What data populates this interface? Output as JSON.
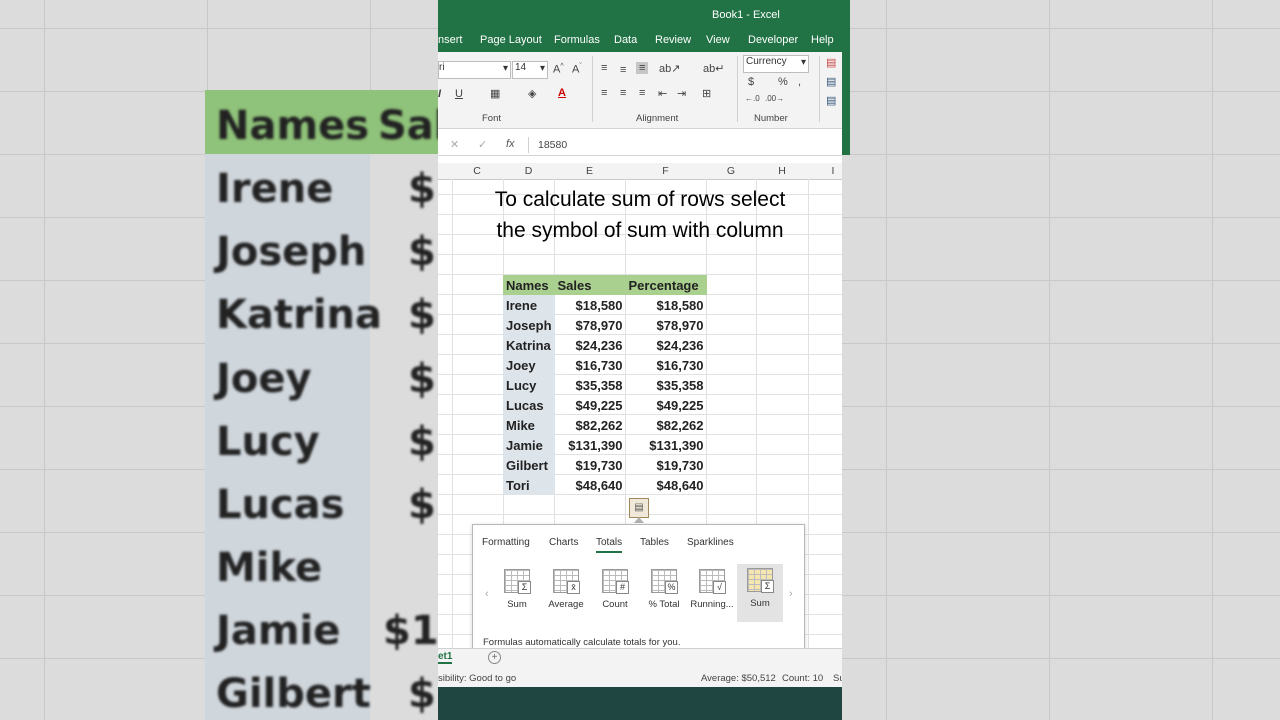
{
  "background": {
    "left_words": [
      "Names",
      "Irene",
      "Joseph",
      "Katrina",
      "Joey",
      "Lucy",
      "Lucas",
      "Mike",
      "Jamie",
      "Gilbert"
    ],
    "left_sales": [
      "Sal",
      "$",
      "$",
      "$",
      "$",
      "$",
      "$",
      "$",
      "$1",
      "$"
    ]
  },
  "title": "Book1  -  Excel",
  "ribbon_tabs": [
    "nsert",
    "Page Layout",
    "Formulas",
    "Data",
    "Review",
    "View",
    "Developer",
    "Help"
  ],
  "ribbon": {
    "font_name": "ri",
    "font_size": "14",
    "number_format": "Currency",
    "group_font": "Font",
    "group_alignment": "Alignment",
    "group_number": "Number"
  },
  "formula_bar": {
    "value": "18580",
    "cancel_glyph": "✕",
    "enter_glyph": "✓",
    "fx_glyph": "fx"
  },
  "columns": [
    "C",
    "D",
    "E",
    "F",
    "G",
    "H",
    "I"
  ],
  "caption_line1": "To calculate sum of rows select",
  "caption_line2": "the symbol of sum with column",
  "table": {
    "headers": [
      "Names",
      "Sales",
      "Percentage"
    ],
    "rows": [
      [
        "Irene",
        "$18,580",
        "$18,580"
      ],
      [
        "Joseph",
        "$78,970",
        "$78,970"
      ],
      [
        "Katrina",
        "$24,236",
        "$24,236"
      ],
      [
        "Joey",
        "$16,730",
        "$16,730"
      ],
      [
        "Lucy",
        "$35,358",
        "$35,358"
      ],
      [
        "Lucas",
        "$49,225",
        "$49,225"
      ],
      [
        "Mike",
        "$82,262",
        "$82,262"
      ],
      [
        "Jamie",
        "$131,390",
        "$131,390"
      ],
      [
        "Gilbert",
        "$19,730",
        "$19,730"
      ],
      [
        "Tori",
        "$48,640",
        "$48,640"
      ]
    ]
  },
  "quick_analysis": {
    "tabs": [
      "Formatting",
      "Charts",
      "Totals",
      "Tables",
      "Sparklines"
    ],
    "active_tab": "Totals",
    "items": [
      {
        "label": "Sum",
        "glyph": "Σ"
      },
      {
        "label": "Average",
        "glyph": "x̄"
      },
      {
        "label": "Count",
        "glyph": "#"
      },
      {
        "label": "% Total",
        "glyph": "%"
      },
      {
        "label": "Running...",
        "glyph": "√"
      },
      {
        "label": "Sum",
        "glyph": "Σ"
      }
    ],
    "footer": "Formulas automatically calculate totals for you."
  },
  "sheet_tab": "et1",
  "status": {
    "accessibility": "sibility: Good to go",
    "average": "Average: $50,512",
    "count": "Count: 10",
    "trailing": "Su"
  },
  "colors": {
    "excel_green": "#217346",
    "header_fill": "#a9d08e",
    "names_fill": "#dde4ea"
  }
}
